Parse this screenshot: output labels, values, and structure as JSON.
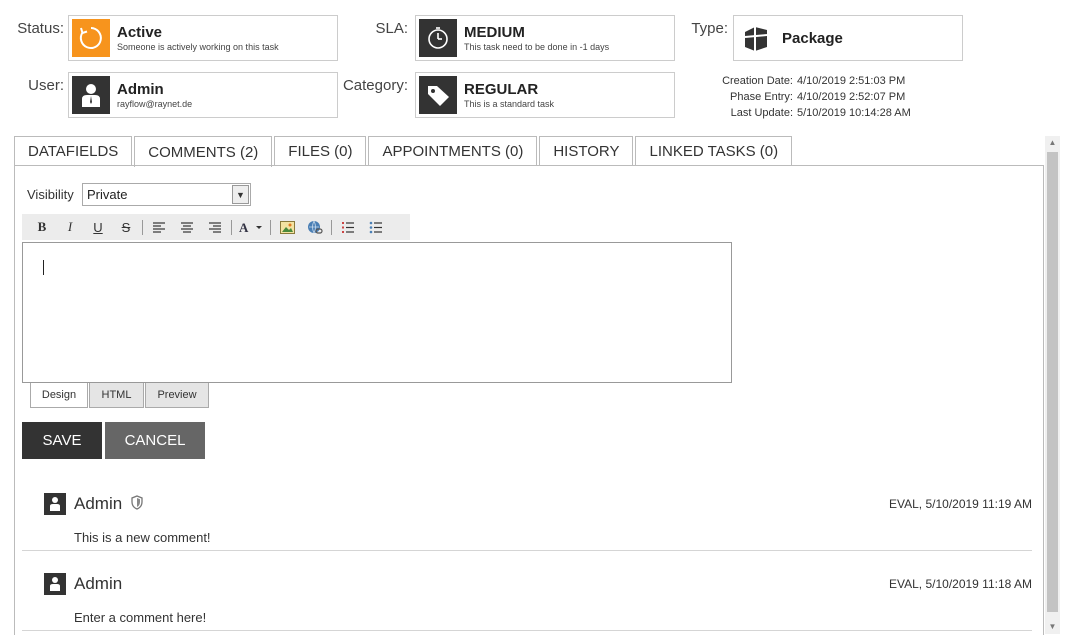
{
  "header": {
    "status": {
      "label": "Status:",
      "title": "Active",
      "subtitle": "Someone is actively working on this task",
      "icon": "refresh-icon",
      "color": "#f7941d"
    },
    "sla": {
      "label": "SLA:",
      "title": "MEDIUM",
      "subtitle": "This task need to be done in -1 days",
      "icon": "stopwatch-icon"
    },
    "type": {
      "label": "Type:",
      "title": "Package",
      "icon": "package-icon"
    },
    "user": {
      "label": "User:",
      "title": "Admin",
      "subtitle": "rayflow@raynet.de",
      "icon": "user-icon"
    },
    "category": {
      "label": "Category:",
      "title": "REGULAR",
      "subtitle": "This is a standard task",
      "icon": "tag-icon"
    },
    "dates": [
      {
        "label": "Creation Date:",
        "value": "4/10/2019 2:51:03 PM"
      },
      {
        "label": "Phase Entry:",
        "value": "4/10/2019 2:52:07 PM"
      },
      {
        "label": "Last Update:",
        "value": "5/10/2019 10:14:28 AM"
      }
    ]
  },
  "tabs": [
    {
      "label": "DATAFIELDS"
    },
    {
      "label": "COMMENTS (2)",
      "active": true
    },
    {
      "label": "FILES (0)"
    },
    {
      "label": "APPOINTMENTS (0)"
    },
    {
      "label": "HISTORY"
    },
    {
      "label": "LINKED TASKS (0)"
    }
  ],
  "comment_form": {
    "visibility_label": "Visibility",
    "visibility_value": "Private",
    "toolbar": [
      "B",
      "I",
      "U",
      "S"
    ],
    "editor_tabs": [
      {
        "label": "Design",
        "active": true
      },
      {
        "label": "HTML"
      },
      {
        "label": "Preview"
      }
    ],
    "save_label": "SAVE",
    "cancel_label": "CANCEL"
  },
  "comments": [
    {
      "author": "Admin",
      "private_icon": "shield-icon",
      "meta": "EVAL, 5/10/2019 11:19 AM",
      "text": "This is a new comment!"
    },
    {
      "author": "Admin",
      "meta": "EVAL, 5/10/2019 11:18 AM",
      "text": "Enter a comment here!"
    }
  ]
}
